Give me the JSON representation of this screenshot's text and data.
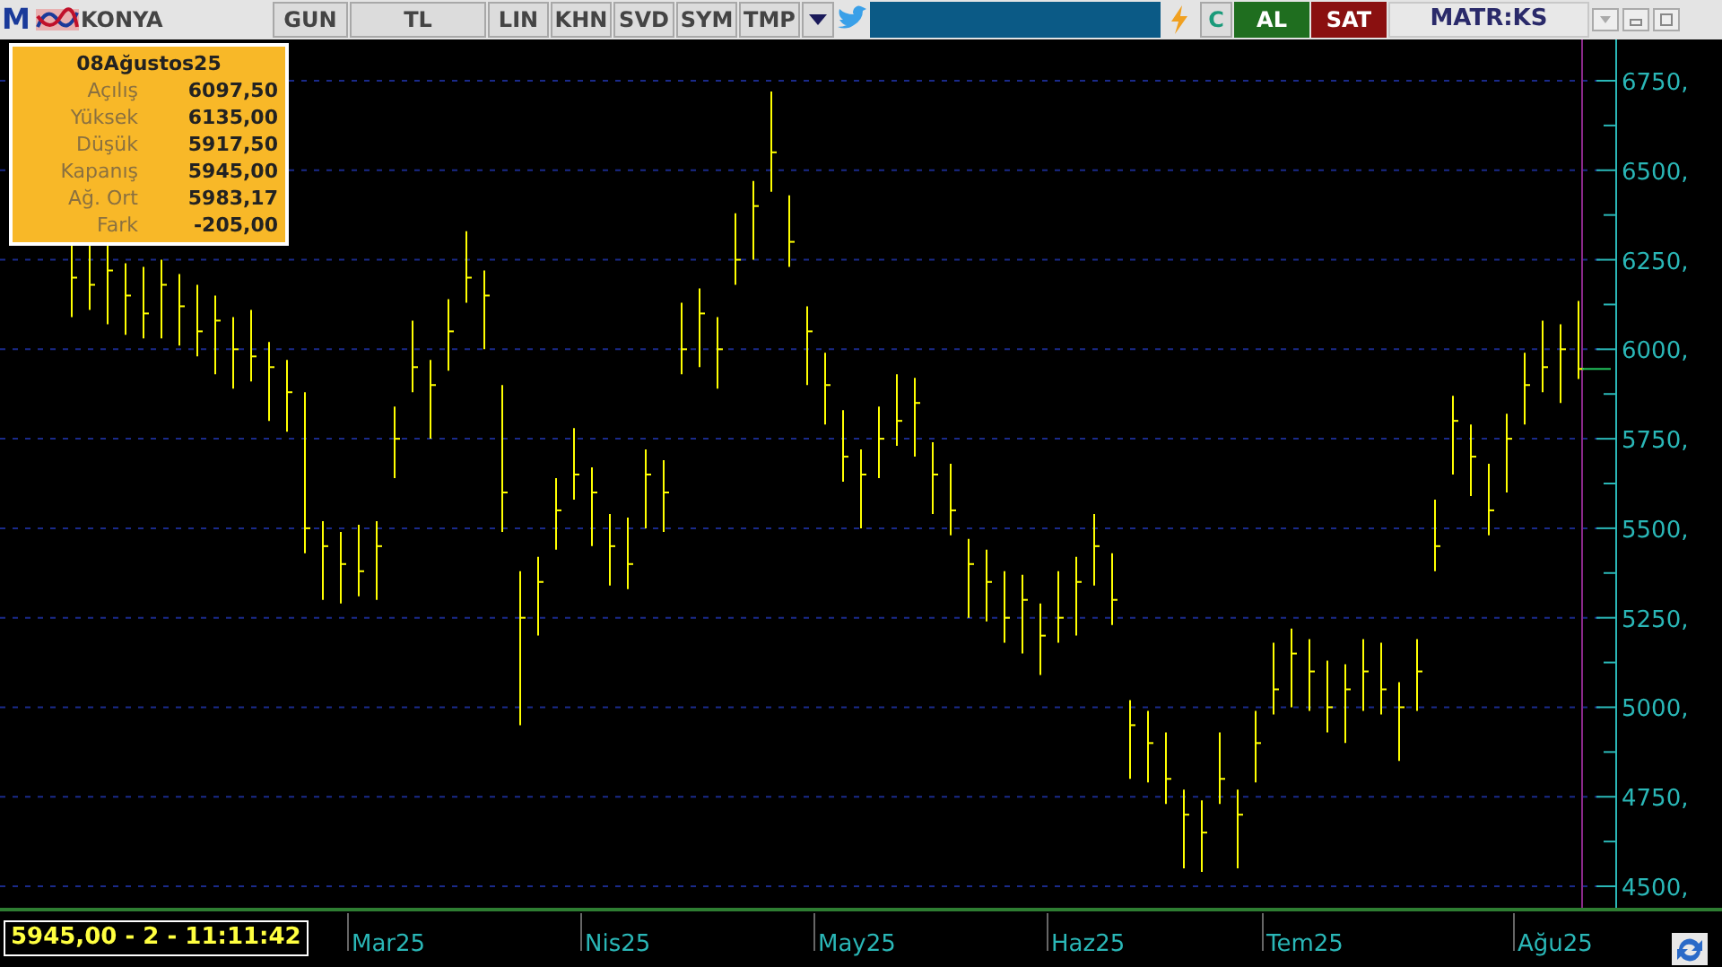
{
  "toolbar": {
    "logo": "M",
    "symbol": "KONYA",
    "buttons": [
      "GUN",
      "TL",
      "LIN",
      "KHN",
      "SVD",
      "SYM",
      "TMP"
    ],
    "refresh": "C",
    "buy": "AL",
    "sell": "SAT",
    "brand": "MATR:KS"
  },
  "tooltip": {
    "date": "08Ağustos25",
    "rows": [
      {
        "label": "Açılış",
        "value": "6097,50"
      },
      {
        "label": "Yüksek",
        "value": "6135,00"
      },
      {
        "label": "Düşük",
        "value": "5917,50"
      },
      {
        "label": "Kapanış",
        "value": "5945,00"
      },
      {
        "label": "Ağ. Ort",
        "value": "5983,17"
      },
      {
        "label": "Fark",
        "value": "-205,00"
      }
    ]
  },
  "status": "5945,00 - 2 - 11:11:42",
  "price_axis": [
    "6750,",
    "6500,",
    "6250,",
    "6000,",
    "5750,",
    "5500,",
    "5250,",
    "5000,",
    "4750,",
    "4500,"
  ],
  "time_axis": [
    "Mar25",
    "Nis25",
    "May25",
    "Haz25",
    "Tem25",
    "Ağu25"
  ]
}
